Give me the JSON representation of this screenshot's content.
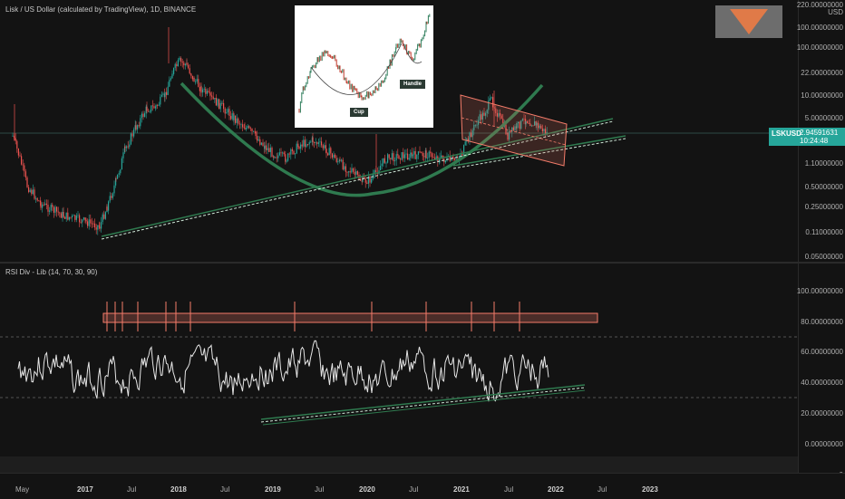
{
  "header": {
    "title": "Lisk / US Dollar (calculated by TradingView), 1D, BINANCE"
  },
  "price_axis": {
    "unit": "USD",
    "ticks": [
      "220.00000000",
      "100.00000000",
      "22.00000000",
      "10.00000000",
      "5.00000000",
      "2.00000000",
      "1.10000000",
      "0.50000000",
      "0.25000000",
      "0.11000000",
      "0.05000000"
    ]
  },
  "price_tag": {
    "symbol": "LSKUSD",
    "price": "2.94591631",
    "countdown": "10:24:48"
  },
  "inset": {
    "cup_label": "Cup",
    "handle_label": "Handle"
  },
  "rsi": {
    "title": "RSI Div - Lib (14, 70, 30, 90)",
    "ticks": [
      "100.00000000",
      "80.00000000",
      "60.00000000",
      "40.00000000",
      "20.00000000",
      "0.00000000"
    ],
    "zero_tick": "0"
  },
  "time_axis": {
    "labels": [
      {
        "text": "May",
        "bold": false
      },
      {
        "text": "2017",
        "bold": true
      },
      {
        "text": "Jul",
        "bold": false
      },
      {
        "text": "2018",
        "bold": true
      },
      {
        "text": "Jul",
        "bold": false
      },
      {
        "text": "2019",
        "bold": true
      },
      {
        "text": "Jul",
        "bold": false
      },
      {
        "text": "2020",
        "bold": true
      },
      {
        "text": "Jul",
        "bold": false
      },
      {
        "text": "2021",
        "bold": true
      },
      {
        "text": "Jul",
        "bold": false
      },
      {
        "text": "2022",
        "bold": true
      },
      {
        "text": "Jul",
        "bold": false
      },
      {
        "text": "2023",
        "bold": true
      }
    ]
  },
  "colors": {
    "background": "#131313",
    "candle_up": "#26a69a",
    "candle_down": "#ef5350",
    "curve": "#2f7a4f",
    "rsi_line": "#e6e6e6",
    "resistance": "#f47c6a"
  }
}
